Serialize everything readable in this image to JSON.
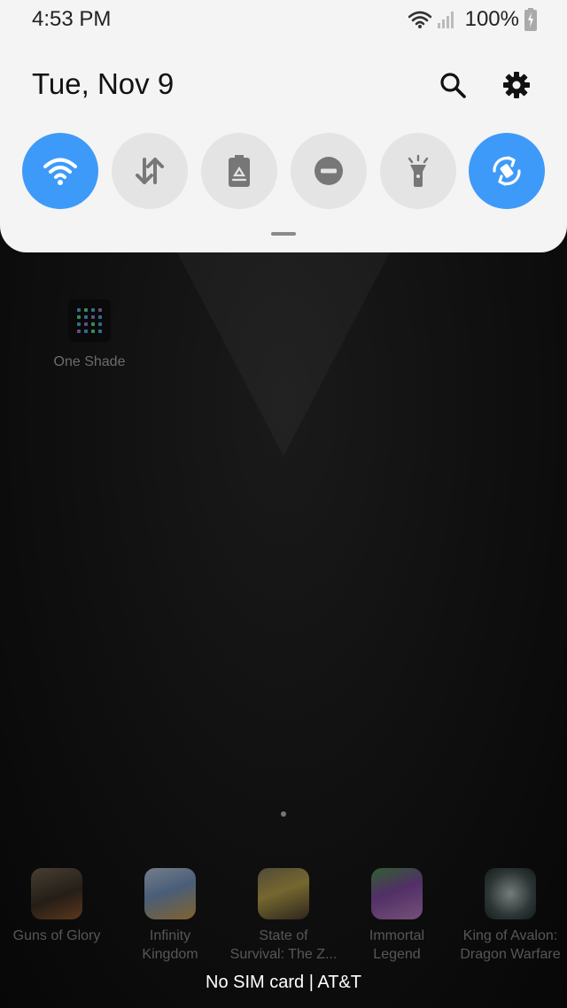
{
  "status_bar": {
    "time": "4:53 PM",
    "battery_percent": "100%",
    "icons": [
      "wifi-icon",
      "signal-icon",
      "battery-charging-icon"
    ]
  },
  "quick_panel": {
    "date": "Tue, Nov 9",
    "header_icons": [
      "search-icon",
      "gear-icon"
    ],
    "tiles": [
      {
        "icon": "wifi-icon",
        "state": "on"
      },
      {
        "icon": "mobile-data-icon",
        "state": "off"
      },
      {
        "icon": "power-saving-icon",
        "state": "off"
      },
      {
        "icon": "do-not-disturb-icon",
        "state": "off"
      },
      {
        "icon": "flashlight-icon",
        "state": "off"
      },
      {
        "icon": "auto-rotate-icon",
        "state": "on"
      }
    ],
    "accent_color": "#3e9af8"
  },
  "home": {
    "app": {
      "label": "One Shade",
      "icon": "one-shade-app-icon"
    },
    "page_count": 1
  },
  "dock": {
    "apps": [
      {
        "label": "Guns of Glory",
        "icon": "guns-of-glory-icon"
      },
      {
        "label": "Infinity\nKingdom",
        "icon": "infinity-kingdom-icon"
      },
      {
        "label": "State of\nSurvival: The Z...",
        "icon": "state-of-survival-icon"
      },
      {
        "label": "Immortal\nLegend",
        "icon": "immortal-legend-icon"
      },
      {
        "label": "King of Avalon:\nDragon Warfare",
        "icon": "king-of-avalon-icon"
      }
    ]
  },
  "carrier_text": "No SIM card | AT&T"
}
